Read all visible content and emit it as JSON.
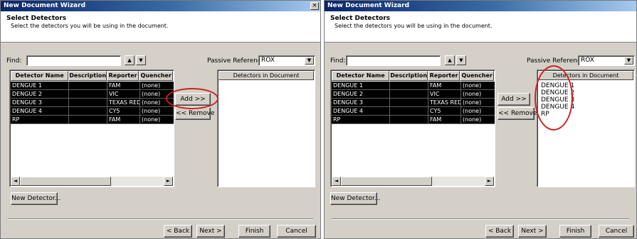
{
  "wizard_title": "New Document Wizard",
  "close_label": "×",
  "header": {
    "title": "Select Detectors",
    "subtitle": "Select the detectors you will be using in the document."
  },
  "find_label": "Find:",
  "find_value": "",
  "passive_label": "Passive Reference:",
  "passive_value": "ROX",
  "up_glyph": "▲",
  "down_glyph": "▼",
  "combo_glyph": "▼",
  "columns": [
    "Detector Name",
    "Description",
    "Reporter",
    "Quencher"
  ],
  "rows": [
    {
      "name": "DENGUE 1",
      "description": "",
      "reporter": "FAM",
      "quencher": "(none)"
    },
    {
      "name": "DENGUE 2",
      "description": "",
      "reporter": "VIC",
      "quencher": "(none)"
    },
    {
      "name": "DENGUE 3",
      "description": "",
      "reporter": "TEXAS RED",
      "quencher": "(none)"
    },
    {
      "name": "DENGUE 4",
      "description": "",
      "reporter": "CY5",
      "quencher": "(none)"
    },
    {
      "name": "RP",
      "description": "",
      "reporter": "FAM",
      "quencher": "(none)"
    }
  ],
  "scroll_left_glyph": "◄",
  "scroll_right_glyph": "►",
  "add_label": "Add >>",
  "remove_label": "<< Remove",
  "doc_list_header": "Detectors in Document",
  "doc_items_left": [],
  "doc_items_right": [
    "DENGUE 1",
    "DENGUE 2",
    "DENGUE 3",
    "DENGUE 4",
    "RP"
  ],
  "new_detector_label": "New Detector...",
  "nav": {
    "back": "< Back",
    "next": "Next >",
    "finish": "Finish",
    "cancel": "Cancel"
  },
  "colors": {
    "annotation": "#cc2222",
    "title_bar": "#0a246a",
    "selection": "#000000"
  }
}
